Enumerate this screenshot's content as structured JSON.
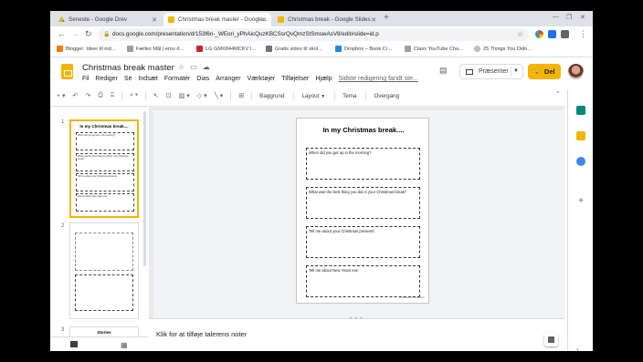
{
  "browser": {
    "tabs": [
      {
        "label": "Seneste - Google Drev",
        "icon": "google-drive-icon",
        "active": false
      },
      {
        "label": "Christmas break master - Google...",
        "icon": "google-slides-icon",
        "active": true
      },
      {
        "label": "Christmas break - Google Slides",
        "icon": "google-slides-icon",
        "active": false
      }
    ],
    "url": "docs.google.com/presentation/d/153f6n-_WEori_yPhAicQuzKBCSsrQvQmzStSmswAsV8/edit#slide=id.p",
    "bookmarks": [
      {
        "label": "Blogger: Ideer til ind...",
        "icon": "blogger-icon",
        "color": "#f57c00"
      },
      {
        "label": "Fælles Mål | emu d...",
        "icon": "emu-icon",
        "color": "#9e9e9e"
      },
      {
        "label": "LG GMX844MCKV I...",
        "icon": "lg-icon",
        "color": "#c62828"
      },
      {
        "label": "Gratis video til skol...",
        "icon": "video-icon",
        "color": "#757575"
      },
      {
        "label": "Dropbox – Book Cr...",
        "icon": "dropbox-icon",
        "color": "#1e88e5"
      },
      {
        "label": "Class YouTube Cha...",
        "icon": "youtube-icon",
        "color": "#9e9e9e"
      },
      {
        "label": "25 Things You Didn...",
        "icon": "pinterest-icon",
        "color": "#bdbdbd"
      }
    ]
  },
  "app": {
    "doc_title": "Christmas break master",
    "menu": [
      "Fil",
      "Rediger",
      "Se",
      "Indsæt",
      "Formatér",
      "Dias",
      "Arranger",
      "Værktøjer",
      "Tilføjelser",
      "Hjælp"
    ],
    "last_edit": "Sidste redigering fandt ste...",
    "present_label": "Præsenter",
    "share_label": "Del",
    "accent": "#f4b400"
  },
  "toolbar": {
    "background": "Baggrund",
    "layout": "Layout",
    "theme": "Tema",
    "transition": "Overgang"
  },
  "filmstrip": {
    "slides": [
      {
        "num": "1",
        "title": "In my Christmas break...."
      },
      {
        "num": "2",
        "title": ""
      },
      {
        "num": "3",
        "title": "Stories"
      }
    ]
  },
  "slide": {
    "title": "In my Christmas break....",
    "boxes": [
      "When did you get up in the morning?",
      "What was the best thing you did in your Christmas break?",
      "Tell me about your Christmas presents.",
      "Tell me about New Years eve."
    ],
    "copyright": "© Lisbeth Christiansen"
  },
  "notes": {
    "placeholder": "Klik for at tilføje talerens noter"
  }
}
